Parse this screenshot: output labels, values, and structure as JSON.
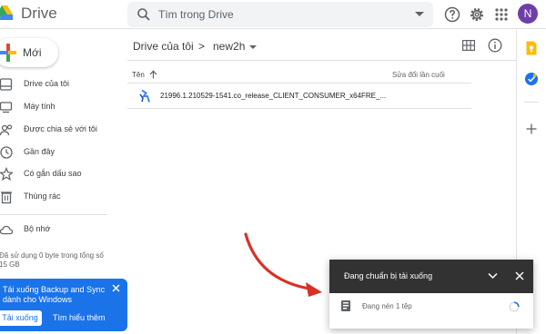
{
  "header": {
    "app_title": "Drive",
    "search_placeholder": "Tìm trong Drive",
    "avatar_initial": "N"
  },
  "sidebar": {
    "new_label": "Mới",
    "items": [
      {
        "label": "Drive của tôi",
        "icon": "my-drive-icon"
      },
      {
        "label": "Máy tính",
        "icon": "computer-icon"
      },
      {
        "label": "Được chia sẻ với tôi",
        "icon": "shared-icon"
      },
      {
        "label": "Gần đây",
        "icon": "clock-icon"
      },
      {
        "label": "Có gắn dấu sao",
        "icon": "star-icon"
      },
      {
        "label": "Thùng rác",
        "icon": "trash-icon"
      },
      {
        "label": "Bộ nhớ",
        "icon": "cloud-icon"
      }
    ],
    "storage_text": "Đã sử dụng 0 byte trong tổng số 15 GB"
  },
  "promo": {
    "text": "Tải xuống Backup and Sync dành cho Windows",
    "primary_button": "Tải xuống",
    "secondary_button": "Tìm hiểu thêm"
  },
  "breadcrumb": {
    "root": "Drive của tôi",
    "separator": ">",
    "current": "new2h"
  },
  "list": {
    "col_name": "Tên",
    "col_modified": "Sửa đổi lần cuối",
    "files": [
      {
        "name": "21996.1.210529-1541.co_release_CLIENT_CONSUMER_x64FRE_..."
      }
    ]
  },
  "download_panel": {
    "title": "Đang chuẩn bị tải xuống",
    "status": "Đang nén 1 tệp"
  },
  "colors": {
    "accent": "#1a73e8",
    "avatar": "#6f3fa8",
    "panel_header": "#323232",
    "arrow": "#d93025"
  }
}
